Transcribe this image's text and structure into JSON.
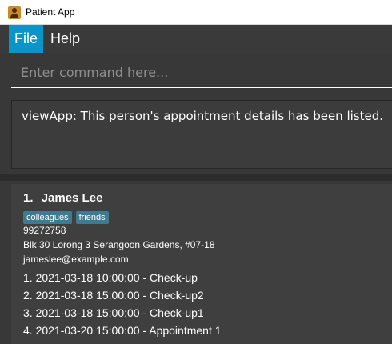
{
  "window": {
    "title": "Patient App",
    "icon": "person-app-icon"
  },
  "menu": {
    "file": "File",
    "help": "Help"
  },
  "command": {
    "placeholder": "Enter command here...",
    "value": ""
  },
  "result": {
    "message": "viewApp: This person's appointment details has been listed."
  },
  "persons": [
    {
      "index": "1.",
      "name": "James Lee",
      "tags": [
        "colleagues",
        "friends"
      ],
      "phone": "99272758",
      "address": "Blk 30 Lorong 3 Serangoon Gardens, #07-18",
      "email": "jameslee@example.com",
      "appointments": [
        "1. 2021-03-18 10:00:00 - Check-up",
        "2. 2021-03-18 15:00:00 - Check-up2",
        "3. 2021-03-18 15:00:00 - Check-up1",
        "4. 2021-03-20 15:00:00 - Appointment 1"
      ]
    }
  ],
  "colors": {
    "menu_active": "#0a95c9",
    "tag_bg": "#3e7b91",
    "background": "#383838",
    "card": "#3f3f3f"
  }
}
